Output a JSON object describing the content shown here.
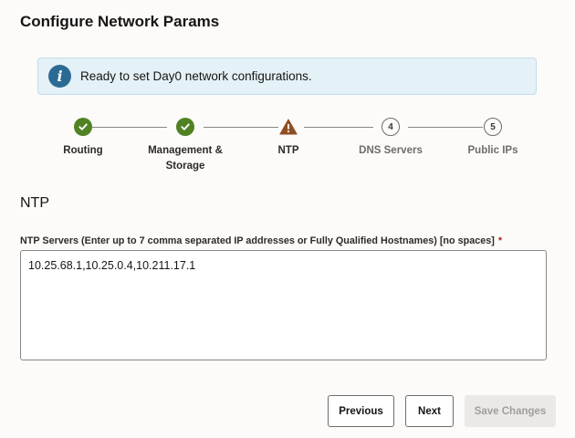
{
  "page": {
    "title": "Configure Network Params"
  },
  "banner": {
    "icon": "info-icon",
    "icon_glyph": "i",
    "message": "Ready to set Day0 network configurations."
  },
  "train": {
    "steps": [
      {
        "label_line1": "Routing",
        "label_line2": "",
        "state": "complete",
        "marker": "check-icon"
      },
      {
        "label_line1": "Management &",
        "label_line2": "Storage",
        "state": "complete",
        "marker": "check-icon"
      },
      {
        "label_line1": "NTP",
        "label_line2": "",
        "state": "current-warning",
        "marker": "warning-icon"
      },
      {
        "label_line1": "DNS Servers",
        "label_line2": "",
        "state": "pending",
        "marker": "4"
      },
      {
        "label_line1": "Public IPs",
        "label_line2": "",
        "state": "pending",
        "marker": "5"
      }
    ]
  },
  "section": {
    "title": "NTP"
  },
  "ntp_field": {
    "label": "NTP Servers (Enter up to 7 comma separated IP addresses or Fully Qualified Hostnames) [no spaces]",
    "required_marker": "*",
    "value": "10.25.68.1,10.25.0.4,10.211.17.1"
  },
  "buttons": {
    "previous": "Previous",
    "next": "Next",
    "save_changes": "Save Changes"
  },
  "colors": {
    "complete": "#508223",
    "warning": "#8f4e22",
    "info": "#2b6b93",
    "required": "#b3251e"
  }
}
